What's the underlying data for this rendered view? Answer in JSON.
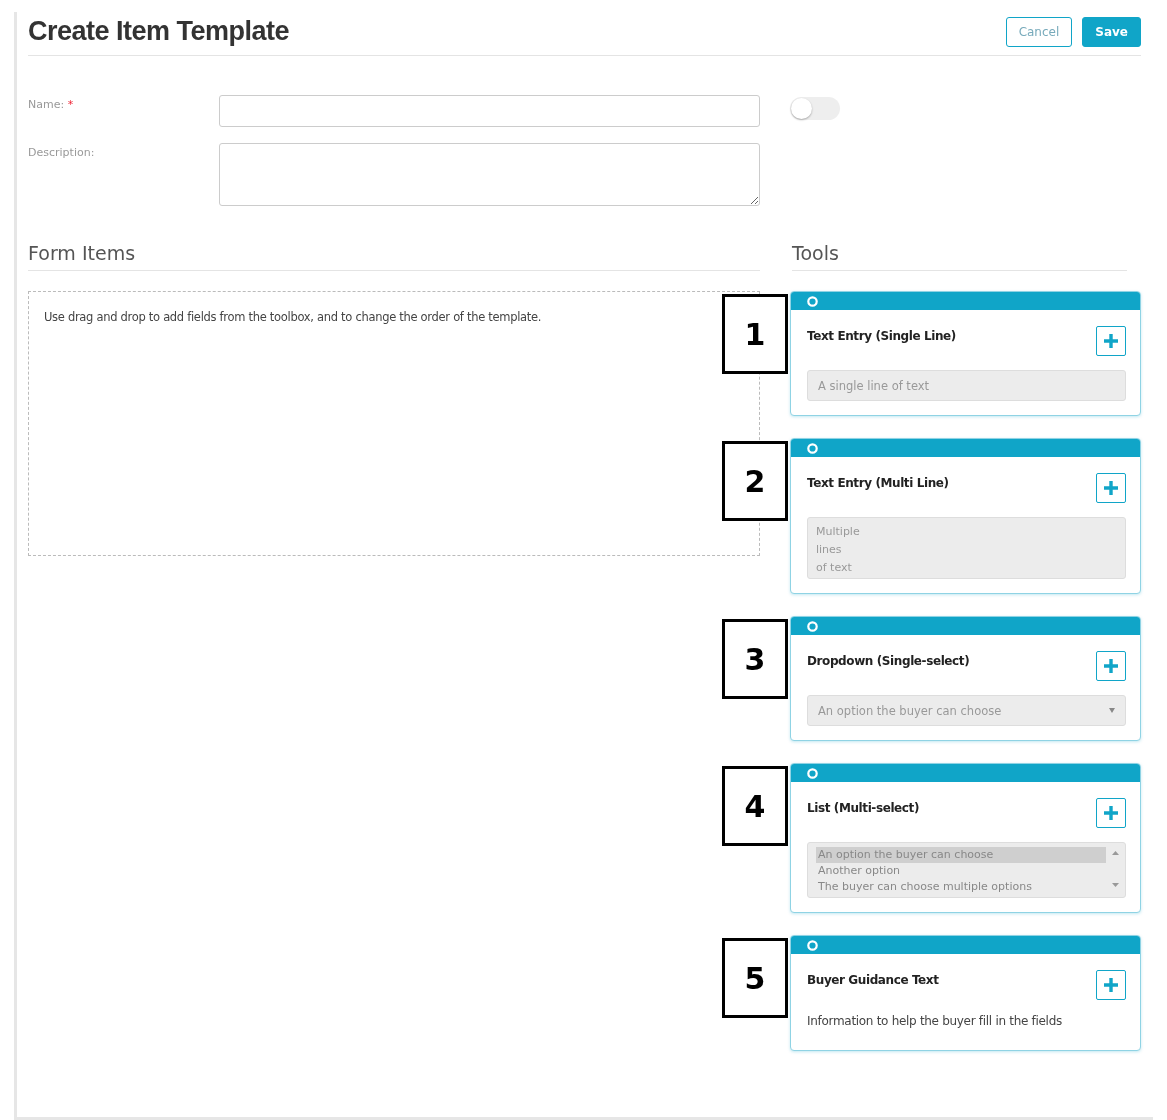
{
  "title": "Create Item Template",
  "actions": [
    {
      "label": "Cancel",
      "kind": "secondary"
    },
    {
      "label": "Save",
      "kind": "primary"
    }
  ],
  "fields": [
    {
      "label": "Name:",
      "required_mark": "*",
      "kind": "input"
    },
    {
      "label": "Description:",
      "kind": "textarea"
    }
  ],
  "toggle": {
    "on": false
  },
  "form_items": {
    "heading": "Form Items",
    "hint": "Use drag and drop to add fields from the toolbox, and to change the order of the template."
  },
  "tools": {
    "heading": "Tools",
    "items": [
      {
        "callout": "1",
        "title": "Text Entry (Single Line)",
        "kind": "single_line",
        "preview": "A single line of text"
      },
      {
        "callout": "2",
        "title": "Text Entry (Multi Line)",
        "kind": "multi_line",
        "preview_lines": [
          "Multiple",
          "lines",
          "of text"
        ]
      },
      {
        "callout": "3",
        "title": "Dropdown (Single-select)",
        "kind": "dropdown",
        "preview": "An option the buyer can choose"
      },
      {
        "callout": "4",
        "title": "List (Multi-select)",
        "kind": "list",
        "options": [
          {
            "label": "An option the buyer can choose",
            "selected": true
          },
          {
            "label": "Another option",
            "selected": false
          },
          {
            "label": "The buyer can choose multiple options",
            "selected": false
          }
        ]
      },
      {
        "callout": "5",
        "title": "Buyer Guidance Text",
        "kind": "guidance",
        "preview": "Information to help the buyer fill in the fields"
      }
    ]
  }
}
